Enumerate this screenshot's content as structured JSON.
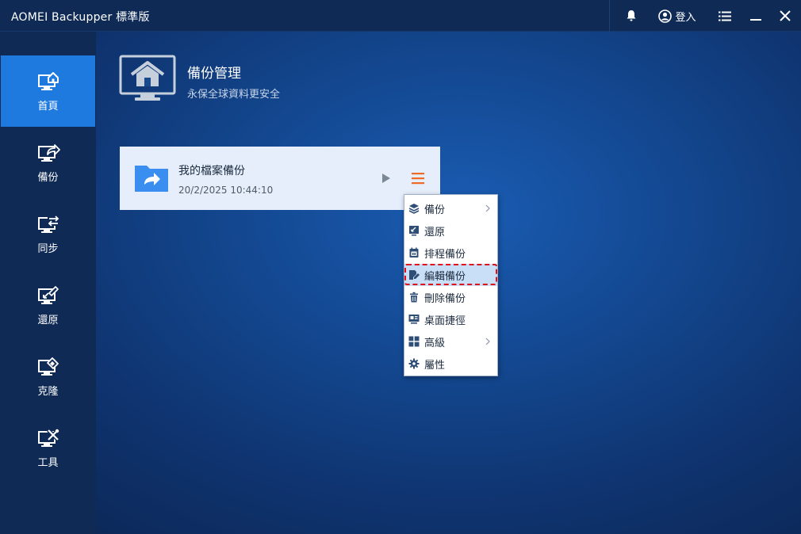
{
  "window": {
    "title": "AOMEI Backupper 標準版",
    "login_label": "登入"
  },
  "sidebar": {
    "items": [
      {
        "label": "首頁",
        "icon": "home-monitor-icon",
        "active": true
      },
      {
        "label": "備份",
        "icon": "backup-monitor-icon"
      },
      {
        "label": "同步",
        "icon": "sync-monitor-icon"
      },
      {
        "label": "還原",
        "icon": "restore-monitor-icon"
      },
      {
        "label": "克隆",
        "icon": "clone-monitor-icon"
      },
      {
        "label": "工具",
        "icon": "tools-monitor-icon"
      }
    ]
  },
  "header": {
    "title": "備份管理",
    "subtitle": "永保全球資料更安全"
  },
  "task": {
    "name": "我的檔案備份",
    "time": "20/2/2025 10:44:10"
  },
  "context_menu": {
    "items": [
      {
        "label": "備份",
        "icon": "layers-icon",
        "submenu": true
      },
      {
        "label": "還原",
        "icon": "restore-icon",
        "submenu": false
      },
      {
        "label": "排程備份",
        "icon": "calendar-icon",
        "submenu": false
      },
      {
        "label": "編輯備份",
        "icon": "edit-icon",
        "submenu": false,
        "highlighted": true
      },
      {
        "label": "刪除備份",
        "icon": "trash-icon",
        "submenu": false
      },
      {
        "label": "桌面捷徑",
        "icon": "shortcut-icon",
        "submenu": false
      },
      {
        "label": "高級",
        "icon": "grid-icon",
        "submenu": true
      },
      {
        "label": "屬性",
        "icon": "gear-icon",
        "submenu": false
      }
    ]
  },
  "colors": {
    "accent": "#1f7ae0",
    "sidebar_bg": "#0e2a55",
    "menu_button": "#f06a23",
    "highlight_border": "#e0101b"
  }
}
